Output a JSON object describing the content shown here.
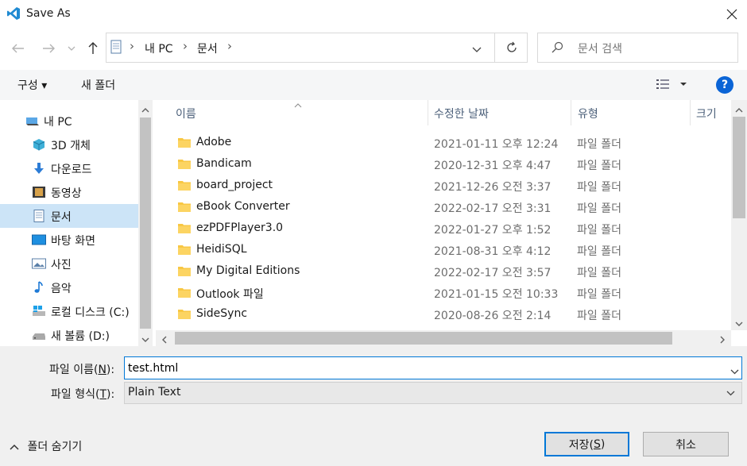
{
  "window": {
    "title": "Save As",
    "close_symbol": "✕"
  },
  "address": {
    "crumbs": [
      "내 PC",
      "문서"
    ],
    "search_placeholder": "문서 검색"
  },
  "toolbar": {
    "organize_label": "구성 ▾",
    "new_folder_label": "새 폴더",
    "help_label": "?"
  },
  "nav": {
    "items": [
      {
        "label": "내 PC",
        "icon": "pc-icon"
      },
      {
        "label": "3D 개체",
        "icon": "cube-icon"
      },
      {
        "label": "다운로드",
        "icon": "download-icon"
      },
      {
        "label": "동영상",
        "icon": "video-icon"
      },
      {
        "label": "문서",
        "icon": "document-icon",
        "selected": true
      },
      {
        "label": "바탕 화면",
        "icon": "desktop-icon"
      },
      {
        "label": "사진",
        "icon": "picture-icon"
      },
      {
        "label": "음악",
        "icon": "music-icon"
      },
      {
        "label": "로컬 디스크 (C:)",
        "icon": "windows-drive-icon"
      },
      {
        "label": "새 볼륨 (D:)",
        "icon": "drive-icon"
      }
    ]
  },
  "columns": {
    "name": "이름",
    "modified": "수정한 날짜",
    "type": "유형",
    "size": "크기"
  },
  "files": [
    {
      "name": "Adobe",
      "modified": "2021-01-11 오후 12:24",
      "type": "파일 폴더"
    },
    {
      "name": "Bandicam",
      "modified": "2020-12-31 오후 4:47",
      "type": "파일 폴더"
    },
    {
      "name": "board_project",
      "modified": "2021-12-26 오전 3:37",
      "type": "파일 폴더"
    },
    {
      "name": "eBook Converter",
      "modified": "2022-02-17 오전 3:31",
      "type": "파일 폴더"
    },
    {
      "name": "ezPDFPlayer3.0",
      "modified": "2022-01-27 오후 1:52",
      "type": "파일 폴더"
    },
    {
      "name": "HeidiSQL",
      "modified": "2021-08-31 오후 4:12",
      "type": "파일 폴더"
    },
    {
      "name": "My Digital Editions",
      "modified": "2022-02-17 오전 3:57",
      "type": "파일 폴더"
    },
    {
      "name": "Outlook 파일",
      "modified": "2021-01-15 오전 10:33",
      "type": "파일 폴더"
    },
    {
      "name": "SideSync",
      "modified": "2020-08-26 오전 2:14",
      "type": "파일 폴더"
    }
  ],
  "form": {
    "filename_label": "파일 이름(",
    "filename_key": "N",
    "filename_label_end": "):",
    "filename_value": "test.html",
    "filetype_label": "파일 형식(",
    "filetype_key": "T",
    "filetype_label_end": "):",
    "filetype_value": "Plain Text"
  },
  "footer": {
    "hide_folders_label": "폴더 숨기기",
    "save_label": "저장(",
    "save_key": "S",
    "save_label_end": ")",
    "cancel_label": "취소"
  },
  "colors": {
    "accent": "#0078d7",
    "selected_bg": "#cce4f7",
    "folder_yellow": "#f8c743"
  }
}
